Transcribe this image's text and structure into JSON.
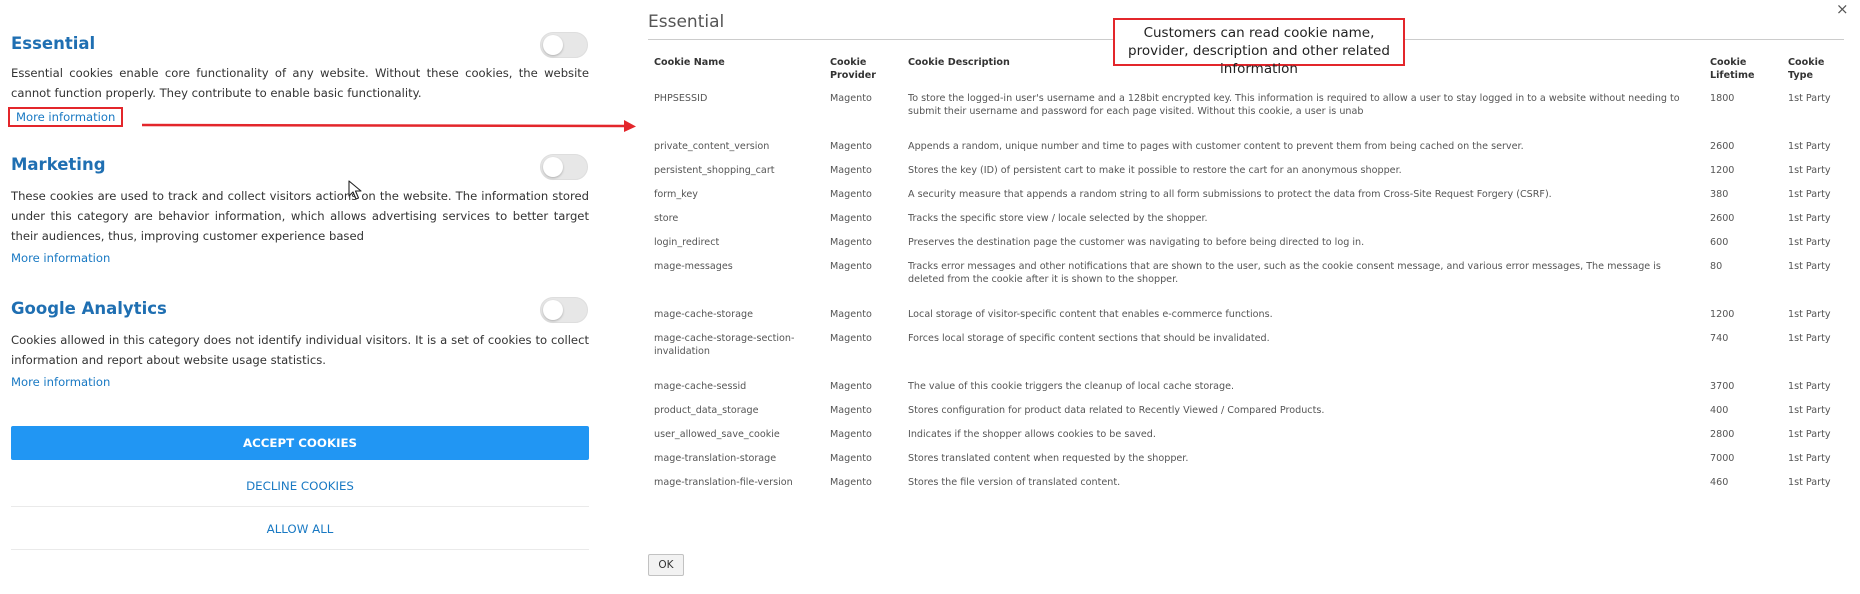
{
  "groups": [
    {
      "title": "Essential",
      "description": "Essential cookies enable core functionality of any website. Without these cookies, the website cannot function properly. They contribute to enable basic functionality.",
      "more_label": "More information"
    },
    {
      "title": "Marketing",
      "description": "These cookies are used to track and collect visitors actions on the website. The information stored under this category are behavior information, which allows advertising services to better target their audiences, thus, improving customer experience based",
      "more_label": "More information"
    },
    {
      "title": "Google Analytics",
      "description": "Cookies allowed in this category does not identify individual visitors. It is a set of cookies to collect information and report about website usage statistics.",
      "more_label": "More information"
    }
  ],
  "buttons": {
    "accept": "ACCEPT COOKIES",
    "decline": "DECLINE COOKIES",
    "allow_all": "ALLOW ALL"
  },
  "modal": {
    "title": "Essential",
    "close_symbol": "×",
    "ok_label": "OK",
    "callout": "Customers can read cookie name, provider, description and other related information",
    "columns": [
      "Cookie Name",
      "Cookie Provider",
      "Cookie Description",
      "Cookie Lifetime",
      "Cookie Type"
    ],
    "rows": [
      [
        "PHPSESSID",
        "Magento",
        "To store the logged-in user's username and a 128bit encrypted key. This information is required to allow a user to stay logged in to a website without needing to submit their username and password for each page visited. Without this cookie, a user is unab",
        "1800",
        "1st Party"
      ],
      [
        "private_content_version",
        "Magento",
        "Appends a random, unique number and time to pages with customer content to prevent them from being cached on the server.",
        "2600",
        "1st Party"
      ],
      [
        "persistent_shopping_cart",
        "Magento",
        "Stores the key (ID) of persistent cart to make it possible to restore the cart for an anonymous shopper.",
        "1200",
        "1st Party"
      ],
      [
        "form_key",
        "Magento",
        "A security measure that appends a random string to all form submissions to protect the data from Cross-Site Request Forgery (CSRF).",
        "380",
        "1st Party"
      ],
      [
        "store",
        "Magento",
        "Tracks the specific store view / locale selected by the shopper.",
        "2600",
        "1st Party"
      ],
      [
        "login_redirect",
        "Magento",
        "Preserves the destination page the customer was navigating to before being directed to log in.",
        "600",
        "1st Party"
      ],
      [
        "mage-messages",
        "Magento",
        "Tracks error messages and other notifications that are shown to the user, such as the cookie consent message, and various error messages, The message is deleted from the cookie after it is shown to the shopper.",
        "80",
        "1st Party"
      ],
      [
        "mage-cache-storage",
        "Magento",
        "Local storage of visitor-specific content that enables e-commerce functions.",
        "1200",
        "1st Party"
      ],
      [
        "mage-cache-storage-section-invalidation",
        "Magento",
        "Forces local storage of specific content sections that should be invalidated.",
        "740",
        "1st Party"
      ],
      [
        "mage-cache-sessid",
        "Magento",
        "The value of this cookie triggers the cleanup of local cache storage.",
        "3700",
        "1st Party"
      ],
      [
        "product_data_storage",
        "Magento",
        "Stores configuration for product data related to Recently Viewed / Compared Products.",
        "400",
        "1st Party"
      ],
      [
        "user_allowed_save_cookie",
        "Magento",
        "Indicates if the shopper allows cookies to be saved.",
        "2800",
        "1st Party"
      ],
      [
        "mage-translation-storage",
        "Magento",
        "Stores translated content when requested by the shopper.",
        "7000",
        "1st Party"
      ],
      [
        "mage-translation-file-version",
        "Magento",
        "Stores the file version of translated content.",
        "460",
        "1st Party"
      ]
    ]
  },
  "colors": {
    "accent": "#2196f3",
    "link": "#1979c3",
    "heading": "#1f6fb2",
    "annotation": "#e3262b"
  }
}
